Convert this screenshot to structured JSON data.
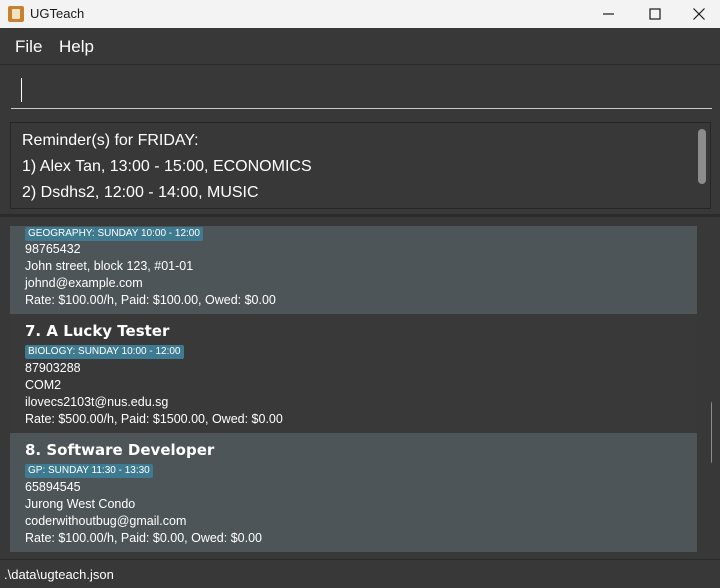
{
  "window": {
    "title": "UGTeach"
  },
  "menu": {
    "file": "File",
    "help": "Help"
  },
  "command": {
    "value": "",
    "placeholder": ""
  },
  "result": {
    "lines": [
      "Reminder(s) for FRIDAY:",
      "1) Alex Tan, 13:00 - 15:00, ECONOMICS",
      "2) Dsdhs2, 12:00 - 14:00, MUSIC"
    ]
  },
  "students": [
    {
      "name": "",
      "tag": "GEOGRAPHY: SUNDAY 10:00 - 12:00",
      "phone": "98765432",
      "address": "John street, block 123, #01-01",
      "email": "johnd@example.com",
      "payment": "Rate: $100.00/h, Paid: $100.00, Owed: $0.00"
    },
    {
      "name": "7. A Lucky Tester",
      "tag": "BIOLOGY: SUNDAY 10:00 - 12:00",
      "phone": "87903288",
      "address": "COM2",
      "email": "ilovecs2103t@nus.edu.sg",
      "payment": "Rate: $500.00/h, Paid: $1500.00, Owed: $0.00"
    },
    {
      "name": "8. Software Developer",
      "tag": "GP: SUNDAY 11:30 - 13:30",
      "phone": "65894545",
      "address": "Jurong West Condo",
      "email": "coderwithoutbug@gmail.com",
      "payment": "Rate: $100.00/h, Paid: $0.00, Owed: $0.00"
    }
  ],
  "status": {
    "path": ".\\data\\ugteach.json"
  },
  "icons": {
    "app": "app-icon",
    "minimize": "minimize-icon",
    "maximize": "maximize-icon",
    "close": "close-icon"
  },
  "colors": {
    "background": "#383838",
    "card_light": "#4e5558",
    "card_dark": "#393939",
    "tag": "#3e7b91"
  }
}
